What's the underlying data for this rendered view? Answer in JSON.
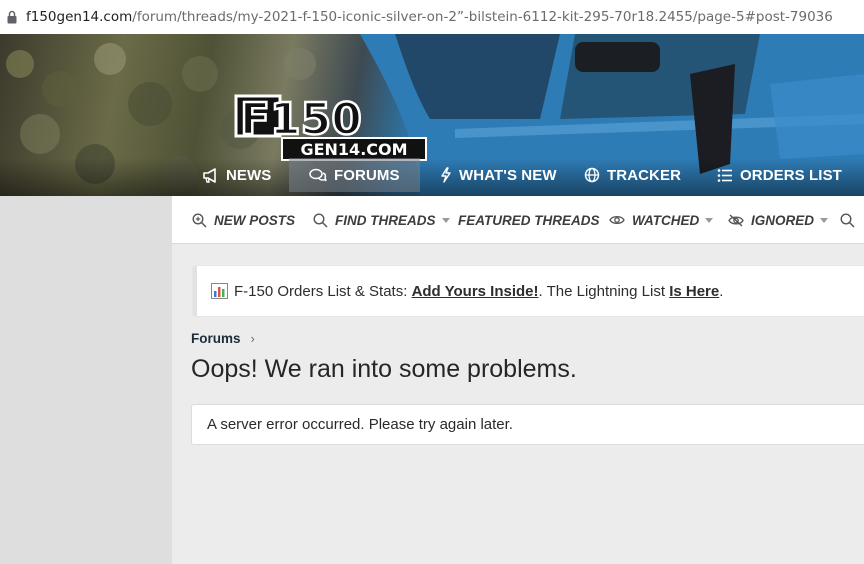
{
  "browser": {
    "url_host": "f150gen14.com",
    "url_path": "/forum/threads/my-2021-f-150-iconic-silver-on-2”-bilstein-6112-kit-295-70r18.2455/page-5#post-79036"
  },
  "logo": {
    "top_text": "F150",
    "bottom_text": "GEN14.COM"
  },
  "main_nav": {
    "items": [
      {
        "label": "NEWS",
        "icon": "megaphone-icon"
      },
      {
        "label": "FORUMS",
        "icon": "chat-bubbles-icon",
        "active": true
      },
      {
        "label": "WHAT'S NEW",
        "icon": "lightning-icon"
      },
      {
        "label": "TRACKER",
        "icon": "globe-icon"
      },
      {
        "label": "ORDERS LIST",
        "icon": "list-icon"
      }
    ]
  },
  "sub_nav": {
    "items": [
      {
        "label": "NEW POSTS",
        "icon": "zoom-in-icon"
      },
      {
        "label": "FIND THREADS",
        "icon": "search-icon",
        "dropdown": true
      },
      {
        "label": "FEATURED THREADS"
      },
      {
        "label": "WATCHED",
        "icon": "eye-icon",
        "dropdown": true
      },
      {
        "label": "IGNORED",
        "icon": "eye-slash-icon",
        "dropdown": true
      }
    ]
  },
  "notice": {
    "prefix": "F-150 Orders List & Stats: ",
    "link1": "Add Yours Inside!",
    "middle": ". The Lightning List ",
    "link2": "Is Here",
    "suffix": "."
  },
  "breadcrumb": {
    "label": "Forums",
    "separator": "›"
  },
  "page_title": "Oops! We ran into some problems.",
  "error_message": "A server error occurred. Please try again later.",
  "colors": {
    "nav_text": "#ffffff",
    "page_bg": "#ececec",
    "truck_blue": "#2f7fb8"
  }
}
